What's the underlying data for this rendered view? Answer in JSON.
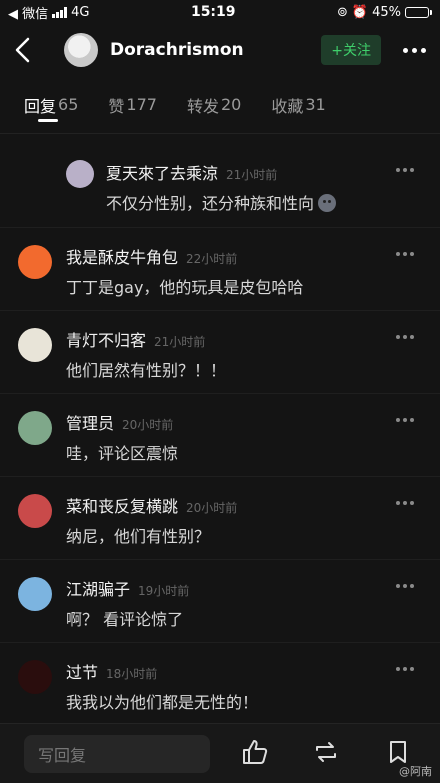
{
  "status_bar": {
    "carrier": "◀ 微信",
    "network": "4G",
    "time": "15:19",
    "battery_percent": "45%",
    "battery_level": 0.45
  },
  "header": {
    "back_icon": "back-arrow-icon",
    "username": "Dorachrismon",
    "follow_label": "+关注",
    "more_icon": "more-dots-icon"
  },
  "tabs": [
    {
      "label": "回复",
      "count": "65",
      "active": true
    },
    {
      "label": "赞",
      "count": "177",
      "active": false
    },
    {
      "label": "转发",
      "count": "20",
      "active": false
    },
    {
      "label": "收藏",
      "count": "31",
      "active": false
    }
  ],
  "replies": [
    {
      "name": "夏天來了去乘涼",
      "time": "21小时前",
      "text": "不仅分性别，还分种族和性向",
      "avatar_color": "#b9b0c8",
      "nested": true
    },
    {
      "name": "我是酥皮牛角包",
      "time": "22小时前",
      "text": "丁丁是gay，他的玩具是皮包哈哈",
      "avatar_color": "#f26a2e"
    },
    {
      "name": "青灯不归客",
      "time": "21小时前",
      "text": "他们居然有性别？！！",
      "avatar_color": "#e8e4d8"
    },
    {
      "name": "管理员",
      "time": "20小时前",
      "text": "哇，评论区震惊",
      "avatar_color": "#7fa88a"
    },
    {
      "name": "菜和丧反复横跳",
      "time": "20小时前",
      "text": "纳尼，他们有性别？",
      "avatar_color": "#c94a4a"
    },
    {
      "name": "江湖骗子",
      "time": "19小时前",
      "text": "啊？ 看评论惊了",
      "avatar_color": "#7cb4e0"
    },
    {
      "name": "过节",
      "time": "18小时前",
      "text": "我我以为他们都是无性的！",
      "avatar_color": "#2a0d0d"
    }
  ],
  "bottom_bar": {
    "reply_placeholder": "写回复",
    "like_icon": "thumbs-up-icon",
    "repost_icon": "repost-icon",
    "bookmark_icon": "bookmark-icon"
  },
  "watermark": "@阿南"
}
